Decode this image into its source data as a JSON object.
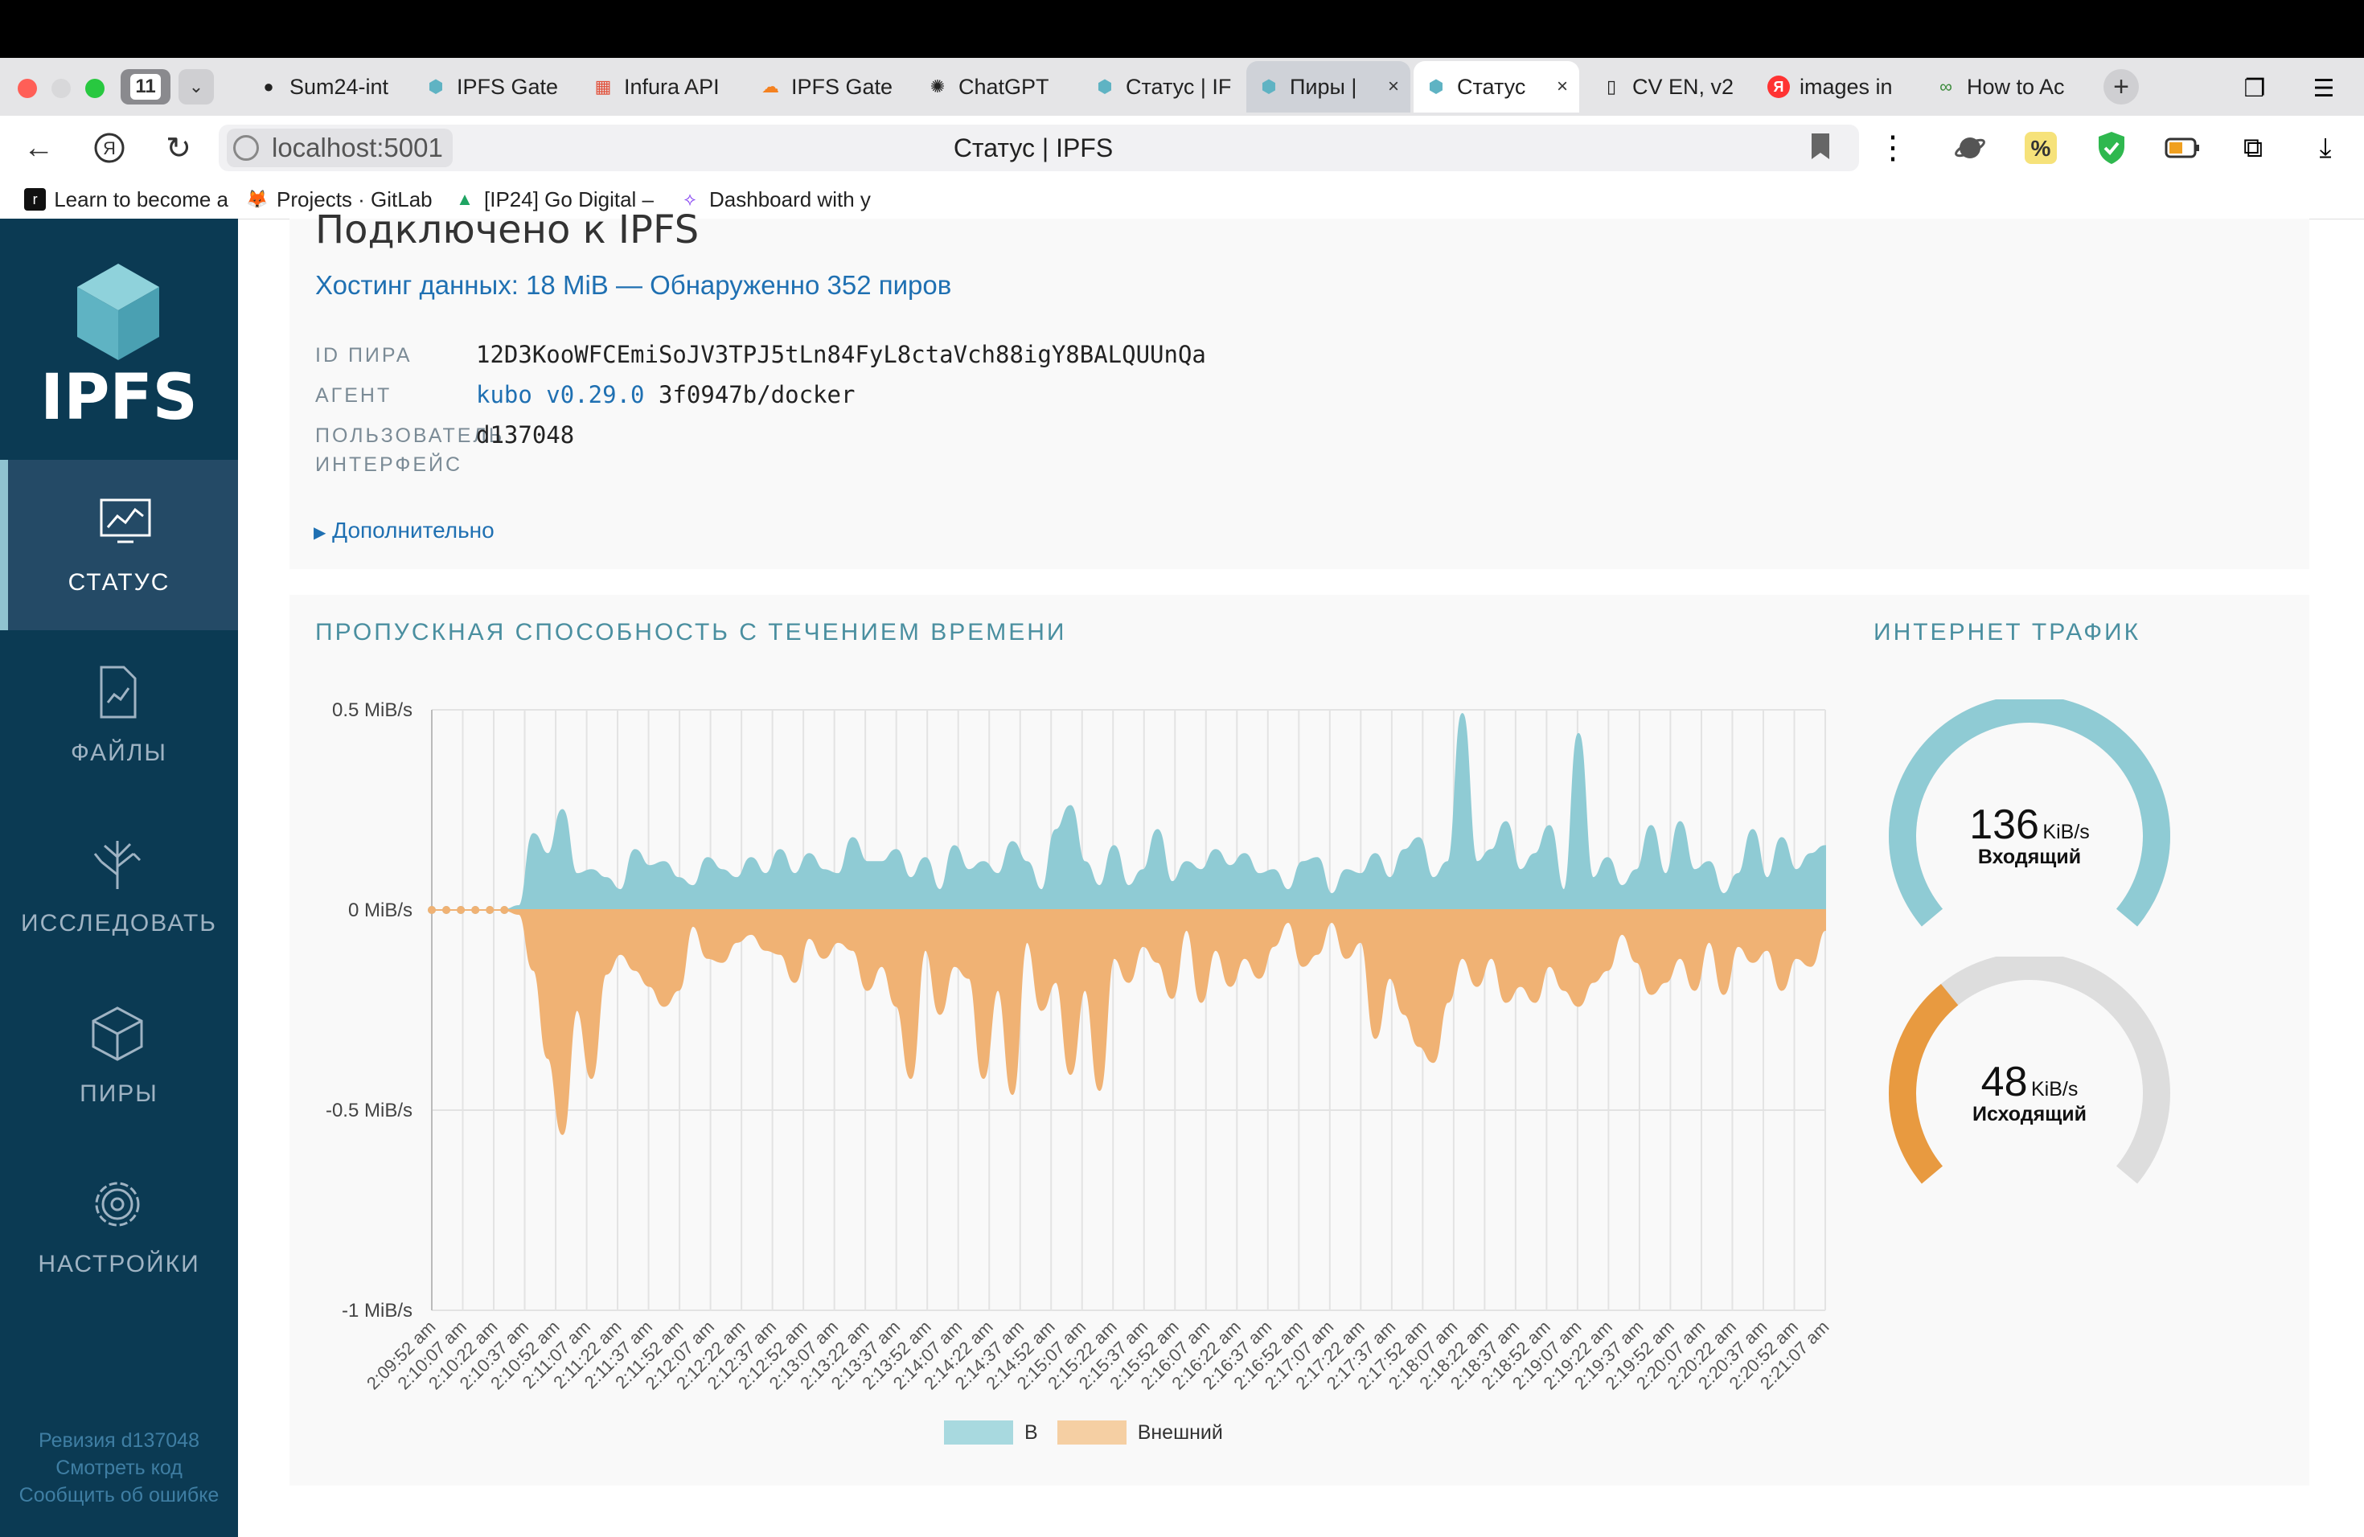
{
  "browser": {
    "tab_count": "11",
    "tabs": [
      {
        "label": "Sum24-int",
        "icon": "github-icon"
      },
      {
        "label": "IPFS Gate",
        "icon": "ipfs-cube-icon"
      },
      {
        "label": "Infura API",
        "icon": "infura-icon"
      },
      {
        "label": "IPFS Gate",
        "icon": "cloudflare-icon"
      },
      {
        "label": "ChatGPT",
        "icon": "chatgpt-icon"
      },
      {
        "label": "Статус | IF",
        "icon": "ipfs-cube-icon"
      },
      {
        "label": "Пиры |",
        "icon": "ipfs-cube-icon"
      },
      {
        "label": "Статус",
        "icon": "ipfs-cube-icon"
      },
      {
        "label": "CV EN, v2",
        "icon": "document-icon"
      },
      {
        "label": "images in",
        "icon": "yandex-icon"
      },
      {
        "label": "How to Ac",
        "icon": "link-icon"
      }
    ],
    "address_host": "localhost:5001",
    "page_title": "Статус | IPFS",
    "bookmarks": [
      {
        "label": "Learn to become a",
        "icon": "roadmap-icon"
      },
      {
        "label": "Projects · GitLab",
        "icon": "gitlab-icon"
      },
      {
        "label": "[IP24] Go Digital –",
        "icon": "google-drive-icon"
      },
      {
        "label": "Dashboard with y",
        "icon": "dashboard-icon"
      }
    ]
  },
  "sidebar": {
    "logo_text": "IPFS",
    "items": [
      {
        "label": "СТАТУС",
        "icon": "status-monitor-icon"
      },
      {
        "label": "ФАЙЛЫ",
        "icon": "files-icon"
      },
      {
        "label": "ИССЛЕДОВАТЬ",
        "icon": "explore-tree-icon"
      },
      {
        "label": "ПИРЫ",
        "icon": "peers-cube-icon"
      },
      {
        "label": "НАСТРОЙКИ",
        "icon": "settings-gear-icon"
      }
    ],
    "footer": {
      "revision": "Ревизия d137048",
      "view_code": "Смотреть код",
      "report_bug": "Сообщить об ошибке"
    }
  },
  "status": {
    "heading": "Подключено к IPFS",
    "hosting": "Хостинг данных: 18 MiB — Обнаруженно 352 пиров",
    "peer_id_label": "ID ПИРА",
    "peer_id": "12D3KooWFCEmiSoJV3TPJ5tLn84FyL8ctaVch88igY8BALQUUnQa",
    "agent_label": "АГЕНТ",
    "agent_link": "kubo v0.29.0",
    "agent_rest": "3f0947b/docker",
    "ui_label_1": "ПОЛЬЗОВАТЕЛЬ",
    "ui_label_2": "ИНТЕРФЕЙС",
    "ui_version": "d137048",
    "more": "Дополнительно"
  },
  "bandwidth": {
    "title": "ПРОПУСКНАЯ СПОСОБНОСТЬ С ТЕЧЕНИЕМ ВРЕМЕНИ",
    "legend_in": "В",
    "legend_out": "Внешний",
    "color_in": "#8fcbd4",
    "color_out": "#f0b274"
  },
  "traffic": {
    "title": "ИНТЕРНЕТ ТРАФИК",
    "incoming_value": "136",
    "incoming_unit": "KiB/s",
    "incoming_label": "Входящий",
    "incoming_fraction": 1.0,
    "outgoing_value": "48",
    "outgoing_unit": "KiB/s",
    "outgoing_label": "Исходящий",
    "outgoing_fraction": 0.35,
    "color_in": "#8fcbd4",
    "color_out": "#e89a40",
    "color_track": "#dddddd"
  },
  "chart_data": {
    "type": "area",
    "title": "ПРОПУСКНАЯ СПОСОБНОСТЬ С ТЕЧЕНИЕМ ВРЕМЕНИ",
    "ylim": [
      -1,
      0.5
    ],
    "y_ticks": [
      "0.5 MiB/s",
      "0 MiB/s",
      "-0.5 MiB/s",
      "-1 MiB/s"
    ],
    "y_tick_values": [
      0.5,
      0,
      -0.5,
      -1
    ],
    "x_tick_labels": [
      "2:09:52 am",
      "2:10:07 am",
      "2:10:22 am",
      "2:10:37 am",
      "2:10:52 am",
      "2:11:07 am",
      "2:11:22 am",
      "2:11:37 am",
      "2:11:52 am",
      "2:12:07 am",
      "2:12:22 am",
      "2:12:37 am",
      "2:12:52 am",
      "2:13:07 am",
      "2:13:22 am",
      "2:13:37 am",
      "2:13:52 am",
      "2:14:07 am",
      "2:14:22 am",
      "2:14:37 am",
      "2:14:52 am",
      "2:15:07 am",
      "2:15:22 am",
      "2:15:37 am",
      "2:15:52 am",
      "2:16:07 am",
      "2:16:22 am",
      "2:16:37 am",
      "2:16:52 am",
      "2:17:07 am",
      "2:17:22 am",
      "2:17:37 am",
      "2:17:52 am",
      "2:18:07 am",
      "2:18:22 am",
      "2:18:37 am",
      "2:18:52 am",
      "2:19:07 am",
      "2:19:22 am",
      "2:19:37 am",
      "2:19:52 am",
      "2:20:07 am",
      "2:20:22 am",
      "2:20:37 am",
      "2:20:52 am",
      "2:21:07 am"
    ],
    "legend_position": "bottom",
    "grid": true,
    "series": [
      {
        "name": "В",
        "values": [
          0,
          0,
          0,
          0,
          0,
          0,
          0.01,
          0.19,
          0.14,
          0.25,
          0.09,
          0.1,
          0.08,
          0.05,
          0.15,
          0.11,
          0.12,
          0.08,
          0.06,
          0.13,
          0.1,
          0.08,
          0.13,
          0.09,
          0.15,
          0.09,
          0.14,
          0.1,
          0.09,
          0.18,
          0.12,
          0.12,
          0.15,
          0.08,
          0.13,
          0.05,
          0.16,
          0.1,
          0.12,
          0.09,
          0.17,
          0.12,
          0.05,
          0.2,
          0.26,
          0.12,
          0.06,
          0.16,
          0.06,
          0.1,
          0.2,
          0.07,
          0.12,
          0.1,
          0.15,
          0.11,
          0.14,
          0.09,
          0.1,
          0.05,
          0.12,
          0.13,
          0.04,
          0.1,
          0.09,
          0.14,
          0.08,
          0.15,
          0.18,
          0.08,
          0.12,
          0.49,
          0.12,
          0.15,
          0.22,
          0.1,
          0.14,
          0.21,
          0.05,
          0.44,
          0.08,
          0.13,
          0.06,
          0.1,
          0.21,
          0.09,
          0.22,
          0.1,
          0.12,
          0.04,
          0.09,
          0.2,
          0.08,
          0.18,
          0.1,
          0.14,
          0.16
        ]
      },
      {
        "name": "Внешний",
        "values": [
          0,
          0,
          0,
          0,
          0,
          0,
          -0.01,
          -0.15,
          -0.37,
          -0.56,
          -0.25,
          -0.42,
          -0.16,
          -0.11,
          -0.15,
          -0.19,
          -0.24,
          -0.2,
          -0.04,
          -0.12,
          -0.13,
          -0.08,
          -0.06,
          -0.1,
          -0.11,
          -0.18,
          -0.07,
          -0.12,
          -0.08,
          -0.1,
          -0.2,
          -0.14,
          -0.24,
          -0.42,
          -0.1,
          -0.26,
          -0.14,
          -0.17,
          -0.42,
          -0.2,
          -0.46,
          -0.08,
          -0.25,
          -0.18,
          -0.41,
          -0.2,
          -0.45,
          -0.12,
          -0.18,
          -0.09,
          -0.13,
          -0.22,
          -0.05,
          -0.23,
          -0.1,
          -0.19,
          -0.12,
          -0.17,
          -0.09,
          -0.03,
          -0.14,
          -0.11,
          -0.03,
          -0.12,
          -0.08,
          -0.32,
          -0.17,
          -0.26,
          -0.34,
          -0.38,
          -0.23,
          -0.12,
          -0.19,
          -0.12,
          -0.23,
          -0.19,
          -0.23,
          -0.14,
          -0.2,
          -0.24,
          -0.18,
          -0.15,
          -0.06,
          -0.13,
          -0.21,
          -0.18,
          -0.12,
          -0.2,
          -0.08,
          -0.21,
          -0.09,
          -0.13,
          -0.1,
          -0.2,
          -0.12,
          -0.14,
          -0.05
        ]
      }
    ]
  }
}
